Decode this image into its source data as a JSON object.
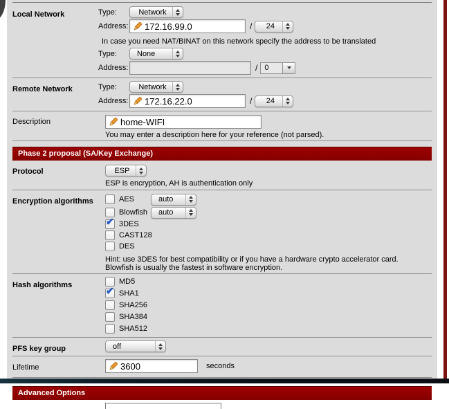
{
  "colors": {
    "section_header": "#8e0000",
    "page_border": "#7c1114",
    "check_blue": "#2257c9"
  },
  "local_network": {
    "label": "Local Network",
    "type_label": "Type:",
    "type_value": "Network",
    "address_label": "Address:",
    "address_value": "172.16.99.0",
    "prefix": "24",
    "nat_note": "In case you need NAT/BINAT on this network specify the address to be translated",
    "nat_type_label": "Type:",
    "nat_type_value": "None",
    "nat_address_label": "Address:",
    "nat_address_value": "",
    "nat_prefix": "0"
  },
  "remote_network": {
    "label": "Remote Network",
    "type_label": "Type:",
    "type_value": "Network",
    "address_label": "Address:",
    "address_value": "172.16.22.0",
    "prefix": "24"
  },
  "description": {
    "label": "Description",
    "value": "home-WIFI",
    "note": "You may enter a description here for your reference (not parsed)."
  },
  "phase2": {
    "header": "Phase 2 proposal (SA/Key Exchange)",
    "protocol": {
      "label": "Protocol",
      "value": "ESP",
      "note": "ESP is encryption, AH is authentication only"
    },
    "encryption": {
      "label": "Encryption algorithms",
      "items": [
        {
          "name": "AES",
          "checked": false,
          "level": "auto"
        },
        {
          "name": "Blowfish",
          "checked": false,
          "level": "auto"
        },
        {
          "name": "3DES",
          "checked": true
        },
        {
          "name": "CAST128",
          "checked": false
        },
        {
          "name": "DES",
          "checked": false
        }
      ],
      "hint": "Hint: use 3DES for best compatibility or if you have a hardware crypto accelerator card. Blowfish is usually the fastest in software encryption."
    },
    "hash": {
      "label": "Hash algorithms",
      "items": [
        {
          "name": "MD5",
          "checked": false
        },
        {
          "name": "SHA1",
          "checked": true
        },
        {
          "name": "SHA256",
          "checked": false
        },
        {
          "name": "SHA384",
          "checked": false
        },
        {
          "name": "SHA512",
          "checked": false
        }
      ]
    },
    "pfs": {
      "label": "PFS key group",
      "value": "off"
    },
    "lifetime": {
      "label": "Lifetime",
      "value": "3600",
      "unit": "seconds"
    }
  },
  "advanced": {
    "header": "Advanced Options"
  }
}
